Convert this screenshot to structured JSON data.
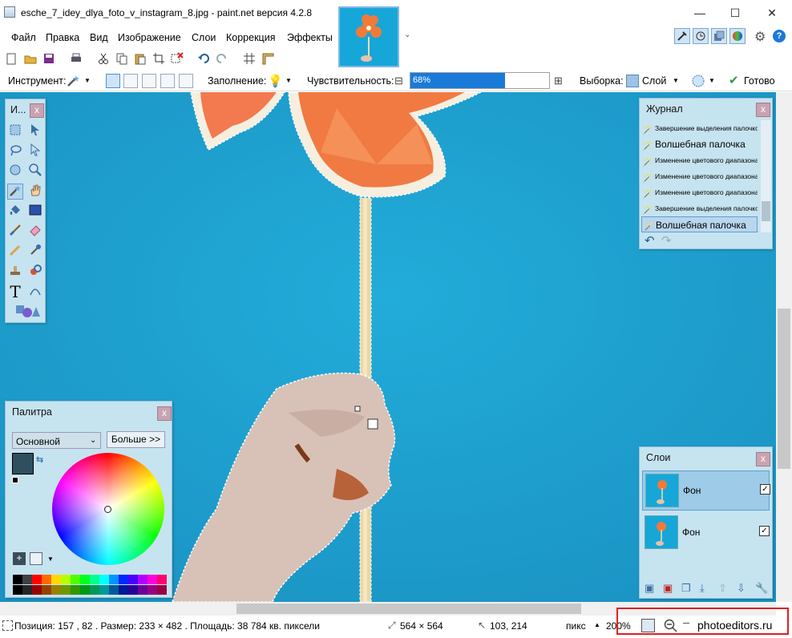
{
  "window": {
    "title": "esche_7_idey_dlya_foto_v_instagram_8.jpg - paint.net версия 4.2.8",
    "minimize": "—",
    "maximize": "☐",
    "close": "✕"
  },
  "menu": [
    "Файл",
    "Правка",
    "Вид",
    "Изображение",
    "Слои",
    "Коррекция",
    "Эффекты"
  ],
  "toolbar": {
    "tool_label": "Инструмент:",
    "fill_label": "Заполнение:",
    "sensitivity_label": "Чувствительность:",
    "sensitivity_value": "68%",
    "sensitivity_fraction": 0.68,
    "selection_label": "Выборка:",
    "selection_value": "Слой",
    "done_label": "Готово",
    "minus": "⊟",
    "plus": "⊞"
  },
  "tools_panel": {
    "title": "И...",
    "close": "x"
  },
  "history": {
    "title": "Журнал",
    "close": "x",
    "items": [
      "Завершение выделения палочкой",
      "Волшебная палочка",
      "Изменение цветового диапазона",
      "Изменение цветового диапазона",
      "Изменение цветового диапазона",
      "Завершение выделения палочкой",
      "Волшебная палочка"
    ]
  },
  "palette": {
    "title": "Палитра",
    "close": "x",
    "mode": "Основной",
    "more_button": "Больше >>",
    "primary_color": "#2f4f5f"
  },
  "layers": {
    "title": "Слои",
    "close": "x",
    "items": [
      {
        "name": "Фон",
        "visible": true
      },
      {
        "name": "Фон",
        "visible": true
      }
    ]
  },
  "status": {
    "position": "Позиция: 157 , 82 . Размер: 233  × 482 . Площадь: 38 784 кв. пиксели",
    "image_size": "564 × 564",
    "cursor": "103, 214",
    "unit": "пикс",
    "zoom": "200%",
    "zoom_minus": "—",
    "watermark": "photoeditors.ru"
  },
  "colors": {
    "canvas": "#1fa4d3",
    "panel": "#c6e3f0",
    "accent": "#1a7ad8",
    "highlight": "#e02020"
  }
}
